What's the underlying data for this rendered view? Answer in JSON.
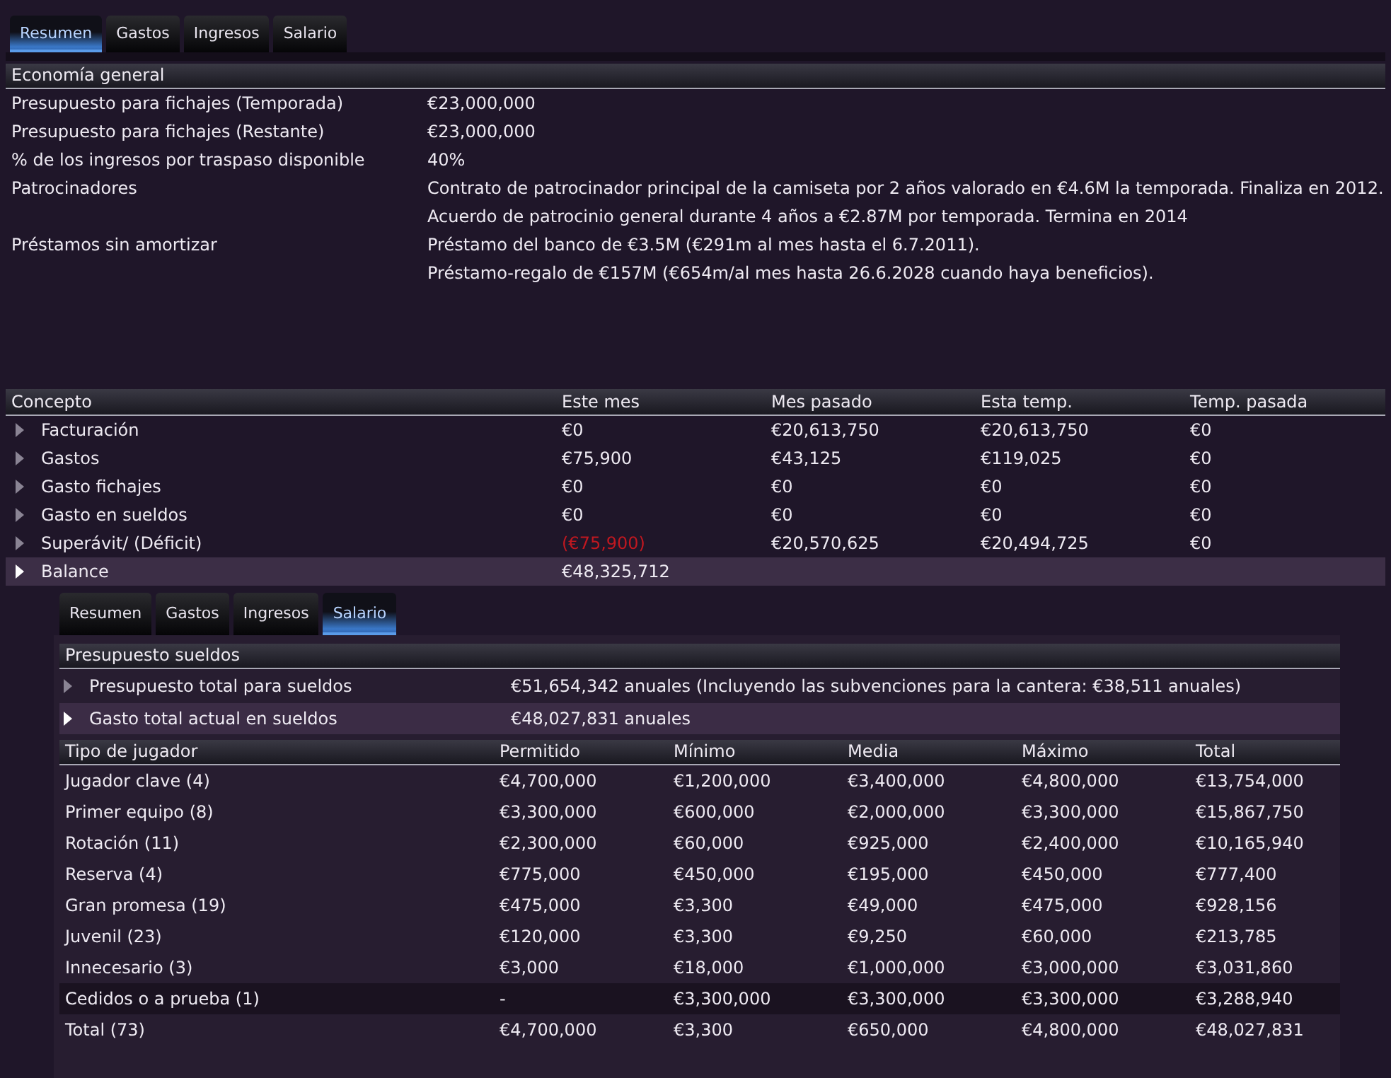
{
  "tabs": [
    {
      "label": "Resumen",
      "selected": true
    },
    {
      "label": "Gastos",
      "selected": false
    },
    {
      "label": "Ingresos",
      "selected": false
    },
    {
      "label": "Salario",
      "selected": false
    }
  ],
  "economy": {
    "title": "Economía general",
    "rows": [
      {
        "label": "Presupuesto para fichajes (Temporada)",
        "values": [
          "€23,000,000"
        ]
      },
      {
        "label": "Presupuesto para fichajes (Restante)",
        "values": [
          "€23,000,000"
        ]
      },
      {
        "label": "% de los ingresos por traspaso disponible",
        "values": [
          "40%"
        ]
      },
      {
        "label": "Patrocinadores",
        "values": [
          "Contrato de patrocinador principal de la camiseta por 2 años valorado en €4.6M la temporada. Finaliza en 2012.",
          "Acuerdo de patrocinio general durante 4 años a €2.87M por temporada. Termina en 2014"
        ]
      },
      {
        "label": "Préstamos sin amortizar",
        "values": [
          "Préstamo del banco de €3.5M (€291m al mes hasta el 6.7.2011).",
          "Préstamo-regalo de €157M (€654m/al mes hasta 26.6.2028 cuando haya beneficios)."
        ]
      }
    ]
  },
  "concepts": {
    "columns": [
      "Concepto",
      "Este mes",
      "Mes pasado",
      "Esta temp.",
      "Temp. pasada"
    ],
    "rows": [
      {
        "selected": false,
        "cells": [
          {
            "text": "Facturación",
            "negative": false
          },
          {
            "text": "€0",
            "negative": false
          },
          {
            "text": "€20,613,750",
            "negative": false
          },
          {
            "text": "€20,613,750",
            "negative": false
          },
          {
            "text": "€0",
            "negative": false
          }
        ]
      },
      {
        "selected": false,
        "cells": [
          {
            "text": "Gastos",
            "negative": false
          },
          {
            "text": "€75,900",
            "negative": false
          },
          {
            "text": "€43,125",
            "negative": false
          },
          {
            "text": "€119,025",
            "negative": false
          },
          {
            "text": "€0",
            "negative": false
          }
        ]
      },
      {
        "selected": false,
        "cells": [
          {
            "text": "Gasto fichajes",
            "negative": false
          },
          {
            "text": "€0",
            "negative": false
          },
          {
            "text": "€0",
            "negative": false
          },
          {
            "text": "€0",
            "negative": false
          },
          {
            "text": "€0",
            "negative": false
          }
        ]
      },
      {
        "selected": false,
        "cells": [
          {
            "text": "Gasto en sueldos",
            "negative": false
          },
          {
            "text": "€0",
            "negative": false
          },
          {
            "text": "€0",
            "negative": false
          },
          {
            "text": "€0",
            "negative": false
          },
          {
            "text": "€0",
            "negative": false
          }
        ]
      },
      {
        "selected": false,
        "cells": [
          {
            "text": "Superávit/ (Déficit)",
            "negative": false
          },
          {
            "text": "(€75,900)",
            "negative": true
          },
          {
            "text": "€20,570,625",
            "negative": false
          },
          {
            "text": "€20,494,725",
            "negative": false
          },
          {
            "text": "€0",
            "negative": false
          }
        ]
      },
      {
        "selected": true,
        "cells": [
          {
            "text": "Balance",
            "negative": false
          },
          {
            "text": "€48,325,712",
            "negative": false
          }
        ]
      }
    ]
  },
  "salary_panel": {
    "tabs": [
      {
        "label": "Resumen",
        "selected": false
      },
      {
        "label": "Gastos",
        "selected": false
      },
      {
        "label": "Ingresos",
        "selected": false
      },
      {
        "label": "Salario",
        "selected": true
      }
    ],
    "budget": {
      "title": "Presupuesto sueldos",
      "rows": [
        {
          "label": "Presupuesto total para sueldos",
          "value": "€51,654,342 anuales (Incluyendo las subvenciones para la cantera: €38,511 anuales)",
          "selected": false
        },
        {
          "label": "Gasto total actual en sueldos",
          "value": "€48,027,831 anuales",
          "selected": true
        }
      ]
    },
    "players": {
      "columns": [
        "Tipo de jugador",
        "Permitido",
        "Mínimo",
        "Media",
        "Máximo",
        "Total"
      ],
      "rows": [
        {
          "cells": [
            "Jugador clave (4)",
            "€4,700,000",
            "€1,200,000",
            "€3,400,000",
            "€4,800,000",
            "€13,754,000"
          ],
          "shaded": false
        },
        {
          "cells": [
            "Primer equipo (8)",
            "€3,300,000",
            "€600,000",
            "€2,000,000",
            "€3,300,000",
            "€15,867,750"
          ],
          "shaded": false
        },
        {
          "cells": [
            "Rotación (11)",
            "€2,300,000",
            "€60,000",
            "€925,000",
            "€2,400,000",
            "€10,165,940"
          ],
          "shaded": false
        },
        {
          "cells": [
            "Reserva (4)",
            "€775,000",
            "€450,000",
            "€195,000",
            "€450,000",
            "€777,400"
          ],
          "shaded": false
        },
        {
          "cells": [
            "Gran promesa (19)",
            "€475,000",
            "€3,300",
            "€49,000",
            "€475,000",
            "€928,156"
          ],
          "shaded": false
        },
        {
          "cells": [
            "Juvenil (23)",
            "€120,000",
            "€3,300",
            "€9,250",
            "€60,000",
            "€213,785"
          ],
          "shaded": false
        },
        {
          "cells": [
            "Innecesario (3)",
            "€3,000",
            "€18,000",
            "€1,000,000",
            "€3,000,000",
            "€3,031,860"
          ],
          "shaded": false
        },
        {
          "cells": [
            "Cedidos o a prueba (1)",
            "-",
            "€3,300,000",
            "€3,300,000",
            "€3,300,000",
            "€3,288,940"
          ],
          "shaded": true
        },
        {
          "cells": [
            "Total  (73)",
            "€4,700,000",
            "€3,300",
            "€650,000",
            "€4,800,000",
            "€48,027,831"
          ],
          "shaded": false
        }
      ]
    }
  }
}
